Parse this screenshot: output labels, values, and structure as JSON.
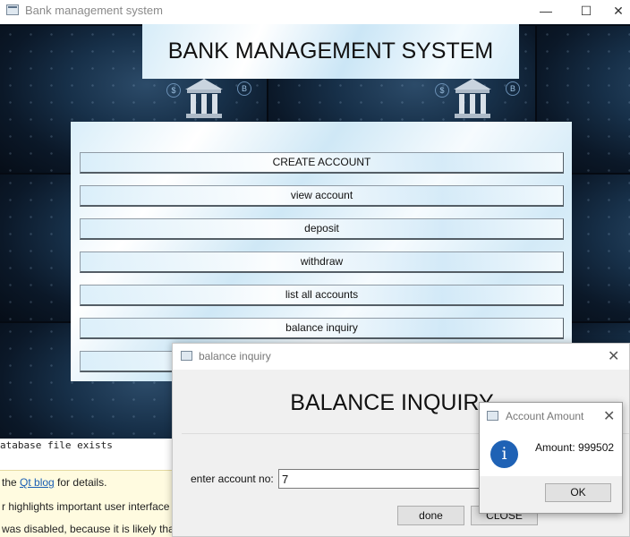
{
  "window": {
    "title": "Bank management system",
    "minimize_glyph": "—",
    "maximize_glyph": "☐",
    "close_glyph": "✕"
  },
  "header": {
    "title": "BANK MANAGEMENT SYSTEM"
  },
  "menu": {
    "buttons": [
      "CREATE ACCOUNT",
      "view account",
      "deposit",
      "withdraw",
      "list all accounts",
      "balance inquiry",
      ""
    ]
  },
  "background_tiles": {
    "coin_glyph": "$",
    "alt_coin_glyph": "B"
  },
  "console": {
    "line": "atabase file exists",
    "info_lines": [
      {
        "prefix": "the ",
        "link": "Qt blog",
        "suffix": " for details."
      },
      {
        "prefix": "r highlights important user interface",
        "link": "",
        "suffix": ""
      },
      {
        "prefix": "was disabled, because it is likely that it",
        "link": "",
        "suffix": ""
      }
    ]
  },
  "dialog": {
    "title": "balance inquiry",
    "close_glyph": "✕",
    "heading": "BALANCE INQUIRY",
    "field_label": "enter account no:",
    "field_value": "7",
    "done_label": "done",
    "close_label": "CLOSE"
  },
  "message_box": {
    "title": "Account Amount",
    "close_glyph": "✕",
    "icon_glyph": "i",
    "text": "Amount: 999502",
    "ok_label": "OK"
  },
  "icons": [
    "window-app-icon",
    "bank-building-icon",
    "coin-icon",
    "info-icon",
    "close-icon"
  ]
}
